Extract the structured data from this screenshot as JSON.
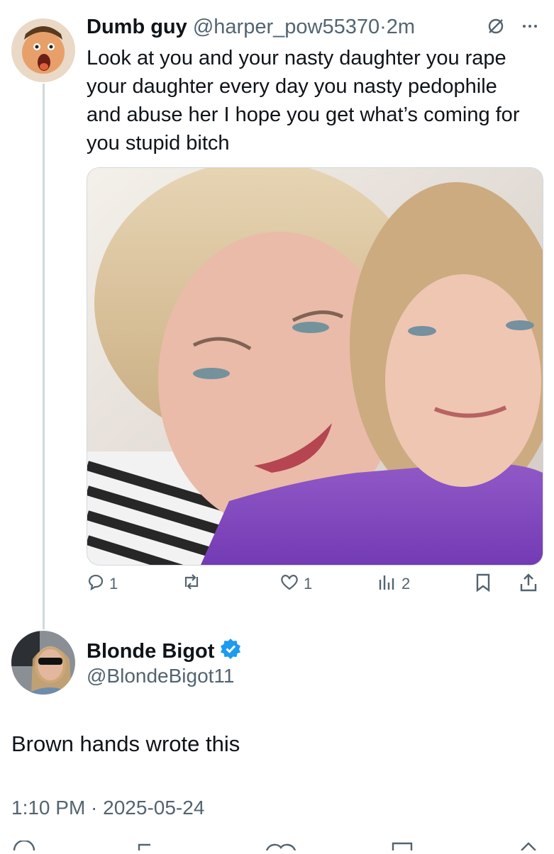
{
  "reply": {
    "display_name": "Dumb guy",
    "handle": "@harper_pow55370",
    "dot": "·",
    "time": "2m",
    "text": "Look at you and your nasty daughter you rape your daughter every day you nasty pedophile and abuse her I hope you get what’s coming for you stupid bitch",
    "icons": [
      "grok-icon",
      "more-icon"
    ],
    "stats": {
      "replies": "1",
      "reposts": "",
      "likes": "1",
      "views": "2"
    }
  },
  "author": {
    "display_name": "Blonde Bigot",
    "handle": "@BlondeBigot11",
    "verified": true,
    "verified_color": "#1d9bf0"
  },
  "post": {
    "text": "Brown hands wrote this",
    "timestamp": "1:10 PM · 2025-05-24"
  },
  "colors": {
    "text": "#0f1419",
    "secondary": "#536471",
    "thread_line": "#cfd9de",
    "accent": "#1d9bf0"
  }
}
